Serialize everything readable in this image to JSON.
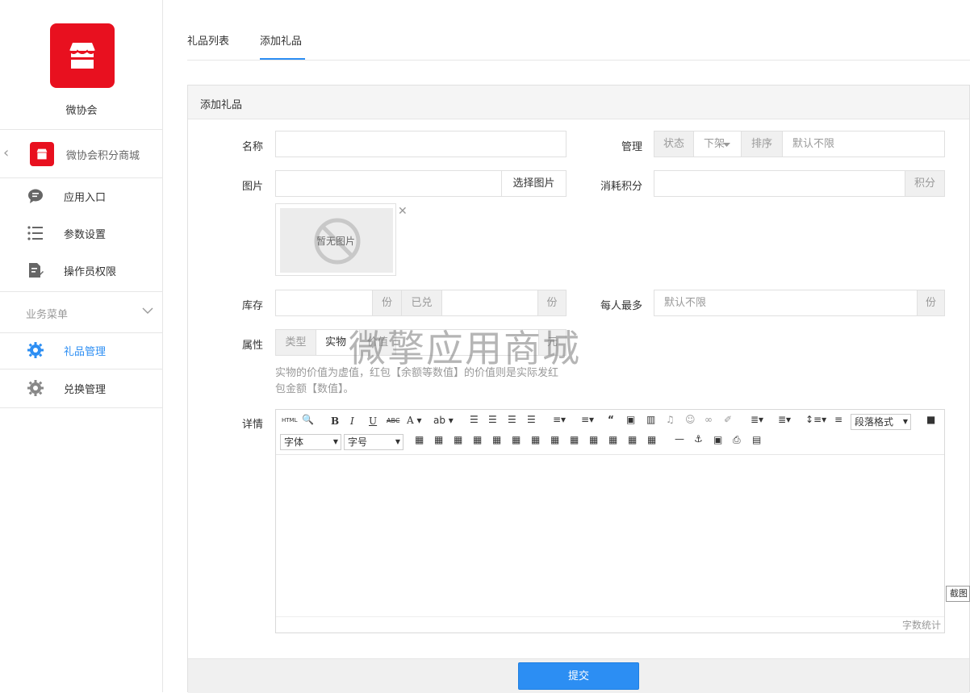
{
  "sidebar": {
    "app_name": "微协会",
    "module_label": "微协会积分商城",
    "nav": [
      {
        "label": "应用入口"
      },
      {
        "label": "参数设置"
      },
      {
        "label": "操作员权限"
      }
    ],
    "section_title": "业务菜单",
    "business": [
      {
        "label": "礼品管理"
      },
      {
        "label": "兑换管理"
      }
    ]
  },
  "tabs": [
    {
      "label": "礼品列表"
    },
    {
      "label": "添加礼品"
    }
  ],
  "panel": {
    "title": "添加礼品"
  },
  "form": {
    "name_label": "名称",
    "image_label": "图片",
    "choose_image": "选择图片",
    "no_image": "暂无图片",
    "manage_label": "管理",
    "status_addon": "状态",
    "status_value": "下架",
    "sort_addon": "排序",
    "sort_placeholder": "默认不限",
    "points_label": "消耗积分",
    "points_addon": "积分",
    "stock_label": "库存",
    "stock_unit": "份",
    "exchanged_addon": "已兑",
    "exchanged_unit": "份",
    "per_person_label": "每人最多",
    "per_person_placeholder": "默认不限",
    "per_person_unit": "份",
    "attr_label": "属性",
    "type_addon": "类型",
    "type_value": "实物",
    "value_addon": "价值",
    "value_suffix": "元",
    "hint": "实物的价值为虚值，红包【余额等数值】的价值则是实际发红包金额【数值】。",
    "detail_label": "详情"
  },
  "editor": {
    "html_btn": "HTML",
    "paragraph_select": "段落格式",
    "font_select": "字体",
    "size_select": "字号",
    "word_count": "字数统计"
  },
  "watermark": "微擎应用商城",
  "screenshot_btn": "截图",
  "submit_label": "提交",
  "colors": {
    "brand_red": "#e8101f",
    "accent_blue": "#2c8ef3"
  }
}
